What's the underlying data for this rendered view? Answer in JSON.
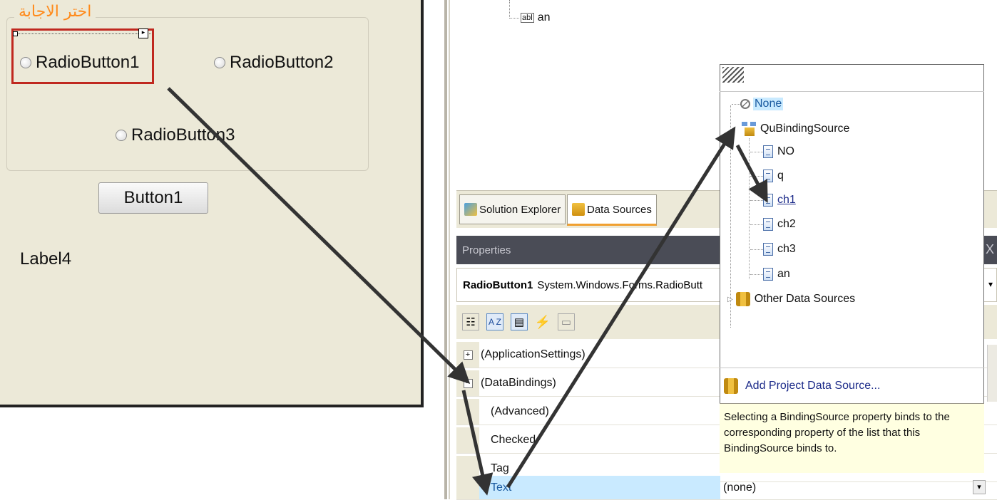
{
  "form": {
    "groupbox_title": "اختر الاجابة",
    "radio1": "RadioButton1",
    "radio2": "RadioButton2",
    "radio3": "RadioButton3",
    "button1": "Button1",
    "label4": "Label4"
  },
  "outline": {
    "an_item": "an",
    "an_icon_text": "abl"
  },
  "tabs": {
    "solution_explorer": "Solution Explorer",
    "data_sources": "Data Sources"
  },
  "properties": {
    "title": "Properties",
    "close": "X",
    "object_name": "RadioButton1",
    "object_type": "System.Windows.Forms.RadioButt",
    "rows": [
      {
        "label": "(ApplicationSettings)",
        "value": "",
        "expander": "+"
      },
      {
        "label": "(DataBindings)",
        "value": "",
        "expander": "−"
      },
      {
        "label": "(Advanced)",
        "value": ""
      },
      {
        "label": "Checked",
        "value": ""
      },
      {
        "label": "Tag",
        "value": ""
      },
      {
        "label": "Text",
        "value": "(none)"
      }
    ]
  },
  "popup": {
    "none": "None",
    "binding_source": "QuBindingSource",
    "fields": [
      "NO",
      "q",
      "ch1",
      "ch2",
      "ch3",
      "an"
    ],
    "other_sources": "Other Data Sources",
    "add_source": "Add Project Data Source...",
    "help": "Selecting a BindingSource property binds to the corresponding property of the list that this BindingSource binds to."
  },
  "colors": {
    "form_bg": "#ece9d8",
    "selection_red": "#c0281f",
    "groupbox_title": "#ff8a1a",
    "selected_row": "#c9eaff",
    "link_blue": "#1d2c8a"
  }
}
